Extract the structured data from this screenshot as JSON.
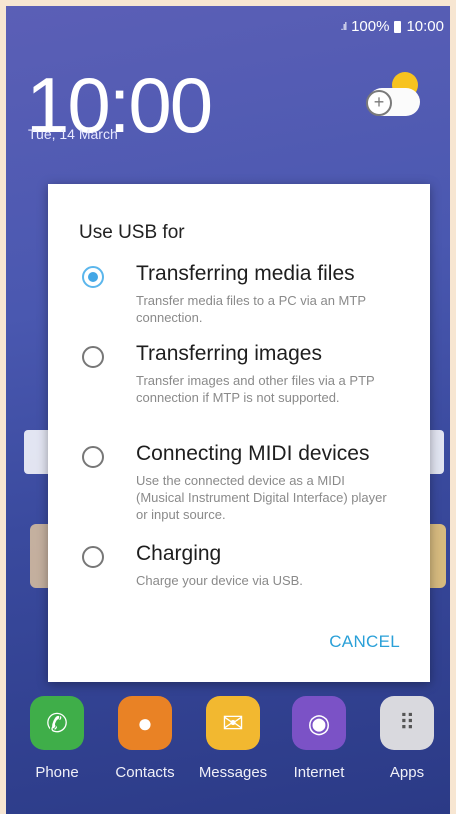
{
  "status_bar": {
    "signal": ".ıl",
    "battery": "100%",
    "time": "10:00"
  },
  "lockscreen": {
    "clock": "10:00",
    "date": "Tue, 14 March"
  },
  "dialog": {
    "title": "Use USB for",
    "options": [
      {
        "title": "Transferring media files",
        "desc": "Transfer media files to a PC via an MTP connection.",
        "selected": true
      },
      {
        "title": "Transferring images",
        "desc": "Transfer images and other files via a PTP connection if MTP is not supported.",
        "selected": false
      },
      {
        "title": "Connecting MIDI devices",
        "desc": "Use the connected device as a MIDI (Musical Instrument Digital Interface) player or input source.",
        "selected": false
      },
      {
        "title": "Charging",
        "desc": "Charge your device via USB.",
        "selected": false
      }
    ],
    "cancel": "CANCEL"
  },
  "dock": [
    {
      "label": "Phone",
      "icon": "phone-icon"
    },
    {
      "label": "Contacts",
      "icon": "contacts-icon"
    },
    {
      "label": "Messages",
      "icon": "messages-icon"
    },
    {
      "label": "Internet",
      "icon": "internet-icon"
    },
    {
      "label": "Apps",
      "icon": "apps-icon"
    }
  ],
  "colors": {
    "accent": "#43a7e6",
    "cancel": "#2aa0d8"
  }
}
